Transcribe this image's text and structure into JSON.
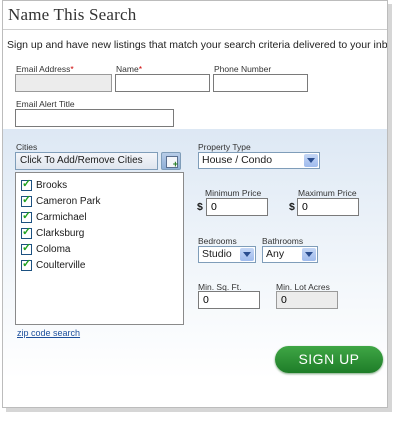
{
  "title": "Name This Search",
  "intro": "Sign up and have new listings that match your search criteria delivered to your inbox.",
  "email": {
    "label": "Email Address",
    "required_mark": "*",
    "value": ""
  },
  "name": {
    "label": "Name",
    "required_mark": "*",
    "value": ""
  },
  "phone": {
    "label": "Phone Number",
    "value": ""
  },
  "alert_title": {
    "label": "Email Alert Title",
    "value": ""
  },
  "cities": {
    "label": "Cities",
    "add_button_label": "Click To Add/Remove Cities",
    "items": [
      {
        "label": "Brooks",
        "checked": true
      },
      {
        "label": "Cameron Park",
        "checked": true
      },
      {
        "label": "Carmichael",
        "checked": true
      },
      {
        "label": "Clarksburg",
        "checked": true
      },
      {
        "label": "Coloma",
        "checked": true
      },
      {
        "label": "Coulterville",
        "checked": true
      }
    ],
    "zip_link": "zip code search"
  },
  "property_type": {
    "label": "Property Type",
    "selected": "House / Condo"
  },
  "min_price": {
    "label": "Minimum Price",
    "currency": "$",
    "value": "0"
  },
  "max_price": {
    "label": "Maximum Price",
    "currency": "$",
    "value": "0"
  },
  "bedrooms": {
    "label": "Bedrooms",
    "selected": "Studio"
  },
  "bathrooms": {
    "label": "Bathrooms",
    "selected": "Any"
  },
  "min_sqft": {
    "label": "Min. Sq. Ft.",
    "value": "0"
  },
  "min_lot": {
    "label": "Min. Lot Acres",
    "value": "0"
  },
  "signup_button": "SIGN UP",
  "colors": {
    "accent_green": "#2f9a37",
    "band_blue": "#dde8f4",
    "required_red": "#cc0000"
  }
}
